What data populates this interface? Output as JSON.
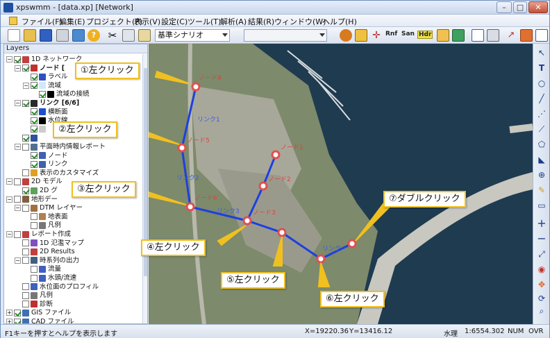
{
  "window": {
    "title": "xpswmm - [data.xp] [Network]",
    "min": "–",
    "max": "□",
    "close": "✕"
  },
  "menu": [
    "ファイル(F)",
    "編集(E)",
    "プロジェクト(P)",
    "表示(V)",
    "設定(C)",
    "ツール(T)",
    "解析(A)",
    "結果(R)",
    "ウィンドウ(W)",
    "ヘルプ(H)"
  ],
  "toolbar": {
    "scenario": "基準シナリオ",
    "scenario2": "",
    "btn_rnf": "Rnf",
    "btn_san": "San",
    "btn_hdr": "Hdr"
  },
  "layers": {
    "title": "Layers",
    "items": [
      {
        "label": "1D ネットワーク",
        "indent": 0,
        "exp": "−",
        "check": true,
        "color": "#c04040"
      },
      {
        "label": "ノード [",
        "indent": 1,
        "exp": "−",
        "check": true,
        "color": "#c03030",
        "bold": true
      },
      {
        "label": "ラベル",
        "indent": 2,
        "exp": "",
        "check": true,
        "color": "#3050c0"
      },
      {
        "label": "流域",
        "indent": 2,
        "exp": "−",
        "check": true,
        "color": "#d0e8f8"
      },
      {
        "label": "流域の接続",
        "indent": 3,
        "exp": "",
        "check": true,
        "color": "#000000"
      },
      {
        "label": "リンク [6/6]",
        "indent": 1,
        "exp": "−",
        "check": true,
        "color": "#2a2a2a",
        "bold": true
      },
      {
        "label": "横断面",
        "indent": 2,
        "exp": "",
        "check": true,
        "color": "#1e4fd0"
      },
      {
        "label": "水位線",
        "indent": 2,
        "exp": "",
        "check": true,
        "color": "#000000"
      },
      {
        "label": "",
        "indent": 2,
        "exp": "",
        "check": true,
        "color": "#cccccc"
      },
      {
        "label": "",
        "indent": 1,
        "exp": "",
        "check": true,
        "color": "#3050a0"
      },
      {
        "label": "平面時内情報レポート",
        "indent": 1,
        "exp": "−",
        "check": false,
        "color": "#507090"
      },
      {
        "label": "ノード",
        "indent": 2,
        "exp": "",
        "check": true,
        "color": "#4060b0"
      },
      {
        "label": "リンク",
        "indent": 2,
        "exp": "",
        "check": true,
        "color": "#4060b0"
      },
      {
        "label": "表示のカスタマイズ",
        "indent": 1,
        "exp": "",
        "check": false,
        "color": "#e0a020"
      },
      {
        "label": "2D モデル",
        "indent": 0,
        "exp": "−",
        "check": false,
        "color": "#c04040"
      },
      {
        "label": "2D グ",
        "indent": 1,
        "exp": "",
        "check": true,
        "color": "#60a060"
      },
      {
        "label": "地形デー",
        "indent": 0,
        "exp": "−",
        "check": false,
        "color": "#806040"
      },
      {
        "label": "DTM レイヤー",
        "indent": 1,
        "exp": "−",
        "check": false,
        "color": "#a07040"
      },
      {
        "label": "地表面",
        "indent": 2,
        "exp": "",
        "check": false,
        "color": "#b08050"
      },
      {
        "label": "凡例",
        "indent": 2,
        "exp": "",
        "check": false,
        "color": "#777777"
      },
      {
        "label": "レポート作成",
        "indent": 0,
        "exp": "−",
        "check": false,
        "color": "#c04040"
      },
      {
        "label": "1D 氾濫マップ",
        "indent": 1,
        "exp": "",
        "check": false,
        "color": "#8050c0"
      },
      {
        "label": "2D Results",
        "indent": 1,
        "exp": "",
        "check": false,
        "color": "#c04040"
      },
      {
        "label": "時系列の出力",
        "indent": 1,
        "exp": "−",
        "check": false,
        "color": "#406080"
      },
      {
        "label": "流量",
        "indent": 2,
        "exp": "",
        "check": false,
        "color": "#4060c0"
      },
      {
        "label": "水頭/流速",
        "indent": 2,
        "exp": "",
        "check": false,
        "color": "#4060c0"
      },
      {
        "label": "水位面のプロフィル",
        "indent": 1,
        "exp": "",
        "check": false,
        "color": "#4060c0"
      },
      {
        "label": "凡例",
        "indent": 1,
        "exp": "",
        "check": false,
        "color": "#777777"
      },
      {
        "label": "診断",
        "indent": 1,
        "exp": "",
        "check": false,
        "color": "#c03030"
      },
      {
        "label": "GIS ファイル",
        "indent": 0,
        "exp": "+",
        "check": true,
        "color": "#4070b0"
      },
      {
        "label": "CAD ファイル",
        "indent": 0,
        "exp": "+",
        "check": true,
        "color": "#4070b0"
      }
    ]
  },
  "map": {
    "nodes": [
      "ノード4",
      "ノード5",
      "ノード6",
      "ノード3",
      "ノード1",
      "ノード2"
    ],
    "links": [
      "リンク1",
      "リンク2",
      "リンク3",
      "リンク"
    ],
    "callouts": [
      "①左クリック",
      "②左クリック",
      "③左クリック",
      "④左クリック",
      "⑤左クリック",
      "⑥左クリック",
      "⑦ダブルクリック"
    ],
    "colors": {
      "link": "#1e3fe0",
      "node": "#e05050",
      "callout_border": "#f0c020",
      "water": "#1d3a4f"
    }
  },
  "status": {
    "help": "F1キーを押すとヘルプを表示します",
    "x": "X=19220.36",
    "y": "Y=13416.12",
    "mode": "水理",
    "scale": "1:6554.302",
    "num": "NUM",
    "ovr": "OVR"
  }
}
